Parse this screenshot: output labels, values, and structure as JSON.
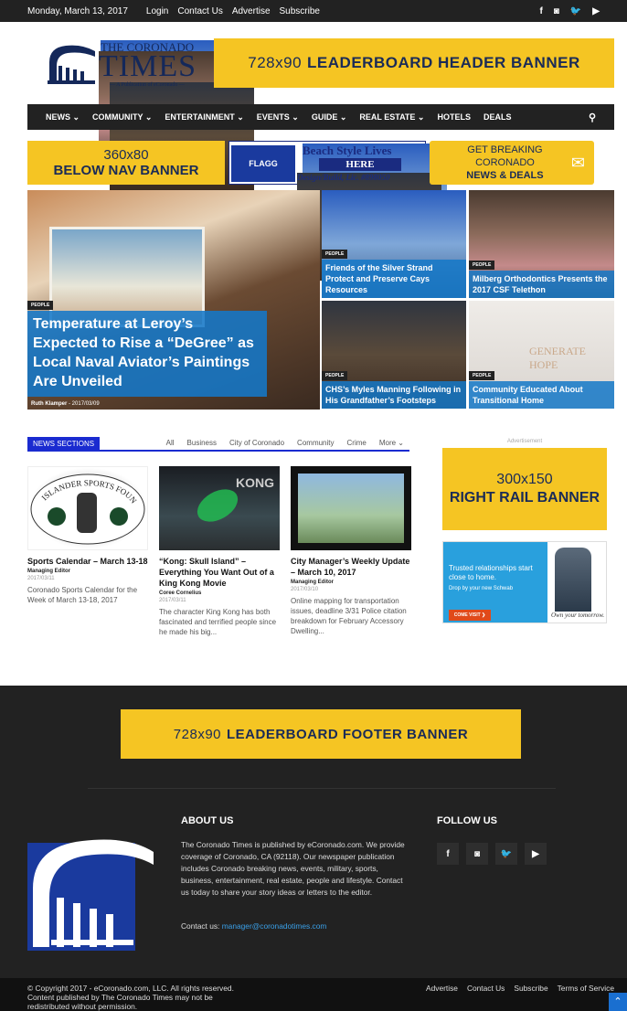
{
  "topbar": {
    "date": "Monday, March 13, 2017",
    "links": [
      "Login",
      "Contact Us",
      "Advertise",
      "Subscribe"
    ],
    "social": [
      "f",
      "◙",
      "🐦",
      "▶"
    ]
  },
  "logo": {
    "line1": "THE CORONADO",
    "line2": "TIMES",
    "line3": "— A Publication of eCoronado —"
  },
  "header_banner": {
    "size": "728x90",
    "label": "LEADERBOARD HEADER BANNER"
  },
  "nav": {
    "items": [
      "NEWS ⌄",
      "COMMUNITY ⌄",
      "ENTERTAINMENT ⌄",
      "EVENTS ⌄",
      "GUIDE ⌄",
      "REAL ESTATE ⌄",
      "HOTELS",
      "DEALS"
    ],
    "search_icon": "search-icon"
  },
  "banners": {
    "below_nav_size": "360x80",
    "below_nav_label": "BELOW NAV BANNER",
    "flagg": {
      "brand": "FLAGG",
      "sub": "COASTAL HOMES",
      "phone": "(619) 696-1600",
      "headline": "Beach Style Lives",
      "here": "HERE",
      "tagline": "Design/Build, Lic. #898050"
    },
    "breaking_line1": "GET BREAKING CORONADO",
    "breaking_line2": "NEWS & DEALS"
  },
  "featured": {
    "main": {
      "tag": "PEOPLE",
      "title": "Temperature at Leroy’s Expected to Rise a “DeGree” as Local Naval Aviator’s Paintings Are Unveiled",
      "author": "Ruth Klamper",
      "date": "- 2017/03/09"
    },
    "tiles": [
      {
        "tag": "PEOPLE",
        "title": "Friends of the Silver Strand Protect and Preserve Cays Resources"
      },
      {
        "tag": "PEOPLE",
        "title": "Milberg Orthodontics Presents the 2017 CSF Telethon"
      },
      {
        "tag": "PEOPLE",
        "title": "CHS’s Myles Manning Following in His Grandfather’s Footsteps"
      },
      {
        "tag": "PEOPLE",
        "title": "Community Educated About Transitional Home",
        "sign": "GENERATE HOPE"
      }
    ]
  },
  "news_sections": {
    "label": "NEWS SECTIONS",
    "tabs": [
      "All",
      "Business",
      "City of Coronado",
      "Community",
      "Crime",
      "More ⌄"
    ],
    "cards": [
      {
        "title": "Sports Calendar – March 13-18",
        "author": "Managing Editor",
        "date": "2017/03/11",
        "excerpt": "Coronado Sports Calendar for the Week of March 13-18, 2017"
      },
      {
        "title": "“Kong: Skull Island” – Everything You Want Out of a King Kong Movie",
        "author": "Coree Cornelius",
        "date": "2017/03/11",
        "excerpt": "The character King Kong has both fascinated and terrified people since he made his big..."
      },
      {
        "title": "City Manager’s Weekly Update – March 10, 2017",
        "author": "Managing Editor",
        "date": "2017/03/10",
        "excerpt": "Online mapping for transportation issues, deadline 3/31 Police citation breakdown for February Accessory Dwelling..."
      }
    ],
    "card1_foundation": "ISLANDER SPORTS FOUNDATION",
    "card2_image_text": "KONG"
  },
  "right_rail": {
    "ad_label": "Advertisement",
    "banner_size": "300x150",
    "banner_label": "RIGHT RAIL BANNER",
    "schwab": {
      "headline": "Trusted relationships start close to home.",
      "sub": "Drop by your new Schwab",
      "button": "COME VISIT ❯",
      "signature": "Own your tomorrow."
    }
  },
  "footer": {
    "banner_size": "728x90",
    "banner_label": "LEADERBOARD FOOTER BANNER",
    "about_title": "ABOUT US",
    "about_text": "The Coronado Times is published by eCoronado.com. We provide coverage of Coronado, CA (92118). Our newspaper publication includes Coronado breaking news, events, military, sports, business, entertainment, real estate, people and lifestyle. Contact us today to share your story ideas or letters to the editor.",
    "contact_label": "Contact us:",
    "contact_email": "manager@coronadotimes.com",
    "follow_title": "FOLLOW US",
    "social": [
      "f",
      "◙",
      "🐦",
      "▶"
    ]
  },
  "copyright": {
    "text": "© Copyright 2017 - eCoronado.com, LLC. All rights reserved. Content published by The Coronado Times may not be redistributed without permission.",
    "links": [
      "Advertise",
      "Contact Us",
      "Subscribe",
      "Terms of Service"
    ],
    "up_icon": "arrow-up-icon"
  },
  "colors": {
    "banner_yellow": "#f5c523",
    "banner_text": "#1a2b57",
    "dark": "#222222",
    "accent_blue": "#1a2bd0",
    "caption_blue": "#1478c8"
  }
}
